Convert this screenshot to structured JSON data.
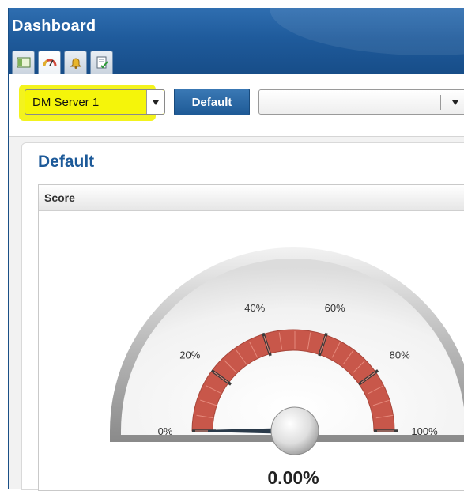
{
  "window": {
    "title": "Dashboard"
  },
  "tabs": [
    {
      "icon": "panel-icon",
      "active": false
    },
    {
      "icon": "gauge-icon",
      "active": true
    },
    {
      "icon": "bell-icon",
      "active": false
    },
    {
      "icon": "report-icon",
      "active": false
    }
  ],
  "toolbar": {
    "server_select": {
      "value": "DM Server 1"
    },
    "default_button": "Default",
    "view_select": {
      "value": ""
    }
  },
  "main": {
    "title": "Default",
    "score_panel": {
      "header": "Score",
      "gauge": {
        "ticks": [
          "0%",
          "20%",
          "40%",
          "60%",
          "80%",
          "100%"
        ],
        "value_fraction": 0,
        "value_label": "0.00%",
        "colors": {
          "band": "#c8574a",
          "needle": "#2a3a4a",
          "accent": "#1d5a99",
          "highlight": "#f3f31e"
        }
      }
    }
  }
}
